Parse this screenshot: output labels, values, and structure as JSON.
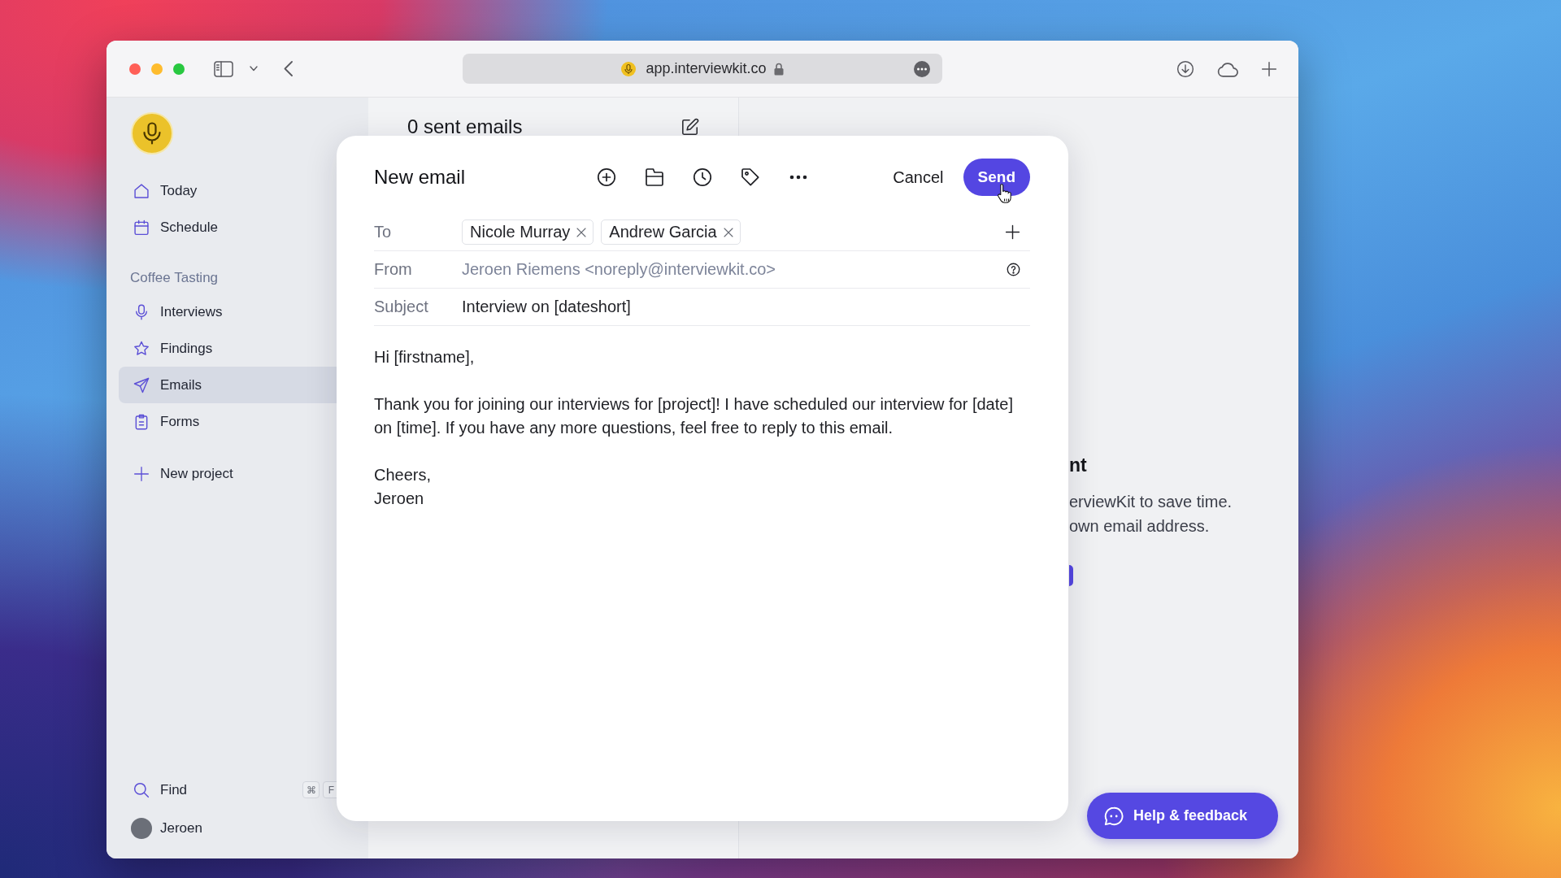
{
  "browser": {
    "url": "app.interviewkit.co"
  },
  "sidebar": {
    "nav": [
      {
        "label": "Today",
        "selected": false
      },
      {
        "label": "Schedule",
        "selected": false
      }
    ],
    "section_title": "Coffee Tasting",
    "project_items": [
      {
        "label": "Interviews",
        "selected": false
      },
      {
        "label": "Findings",
        "selected": false
      },
      {
        "label": "Emails",
        "selected": true
      },
      {
        "label": "Forms",
        "selected": false
      }
    ],
    "new_project": "New project",
    "find": {
      "label": "Find",
      "keys": [
        "⌘",
        "F"
      ]
    },
    "user": {
      "name": "Jeroen"
    }
  },
  "list_pane": {
    "title": "0 sent emails"
  },
  "empty_state": {
    "heading": "nt",
    "lines": [
      "erviewKit to save time.",
      "own email address."
    ]
  },
  "compose": {
    "title": "New email",
    "cancel": "Cancel",
    "send": "Send",
    "to": {
      "label": "To",
      "recipients": [
        "Nicole Murray",
        "Andrew Garcia"
      ]
    },
    "from": {
      "label": "From",
      "value": "Jeroen Riemens <noreply@interviewkit.co>"
    },
    "subject": {
      "label": "Subject",
      "value": "Interview on [dateshort]"
    },
    "body": [
      {
        "lines": [
          "Hi [firstname],"
        ]
      },
      {
        "lines": [
          "Thank you for joining our interviews for [project]! I have scheduled our interview for [date] on [time]. If you have any more questions, feel free to reply to this email."
        ]
      },
      {
        "lines": [
          "Cheers,",
          "Jeroen"
        ]
      }
    ]
  },
  "help_button": {
    "label": "Help & feedback"
  }
}
